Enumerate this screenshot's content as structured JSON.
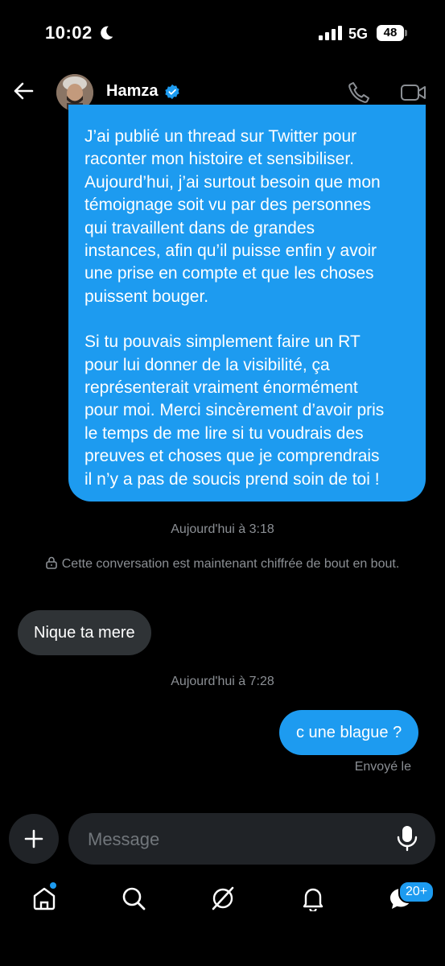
{
  "status_bar": {
    "time": "10:02",
    "network": "5G",
    "battery": "48"
  },
  "header": {
    "name": "Hamza",
    "verified": true
  },
  "messages": {
    "long_outgoing": {
      "para1": "J’ai publié un thread sur Twitter pour\nraconter mon histoire et sensibiliser.\nAujourd’hui, j’ai surtout besoin que mon\ntémoignage soit vu par des personnes\nqui travaillent dans de grandes\ninstances, afin qu’il puisse enfin y avoir\nune prise en compte et que les choses\npuissent bouger.",
      "para2": "Si tu pouvais simplement faire un RT\npour lui donner de la visibilité, ça\nreprésenterait vraiment énormément\npour moi. Merci sincèrement d’avoir pris\nle temps de me lire si tu voudrais des\npreuves et choses que je comprendrais\nil n’y a pas de soucis prend soin de toi !"
    },
    "timestamp1": "Aujourd'hui à 3:18",
    "encryption_notice": "Cette conversation est maintenant chiffrée de bout en bout.",
    "incoming": "Nique ta mere",
    "timestamp2": "Aujourd'hui à 7:28",
    "outgoing_short": "c une blague ?",
    "sent_status": "Envoyé le"
  },
  "composer": {
    "placeholder": "Message"
  },
  "bottom_nav": {
    "messages_badge": "20+"
  },
  "colors": {
    "accent": "#1d9bf0",
    "incoming_bubble": "#2f3336",
    "background": "#000000"
  }
}
